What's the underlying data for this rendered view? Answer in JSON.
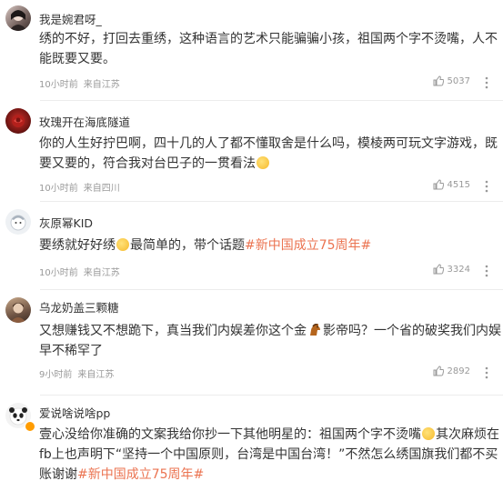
{
  "comments": [
    {
      "username": "我是婉君呀_",
      "text": "绣的不好，打回去重绣，这种语言的艺术只能骗骗小孩，祖国两个字不烫嘴，人不能既要又要。",
      "time": "10小时前",
      "location": "来自江苏",
      "likes": "5037"
    },
    {
      "username": "玫瑰开在海底隧道",
      "text_a": "你的人生好拧巴啊，四十几的人了都不懂取舍是什么吗，模棱两可玩文字游戏，既要又要的，符合我对台巴子的一贯看法",
      "time": "10小时前",
      "location": "来自四川",
      "likes": "4515"
    },
    {
      "username": "灰原幂KID",
      "text_a": "要绣就好好绣",
      "text_b": "最简单的，带个话题",
      "hashtag": "#新中国成立75周年#",
      "time": "10小时前",
      "location": "来自江苏",
      "likes": "3324"
    },
    {
      "username": "乌龙奶盖三颗糖",
      "text_a": "又想赚钱又不想跪下，真当我们内娱差你这个金",
      "text_b": "影帝吗？一个省的破奖我们内娱早不稀罕了",
      "time": "9小时前",
      "location": "来自江苏",
      "likes": "2892"
    },
    {
      "username": "爱说啥说啥pp",
      "text_a": "壹心没给你准确的文案我给你抄一下其他明星的：祖国两个字不烫嘴",
      "text_b": "其次麻烦在fb上也声明下“坚持一个中国原则，台湾是中国台湾！”不然怎么绣国旗我们都不买账谢谢",
      "hashtag": "#新中国成立75周年#"
    }
  ],
  "colors": {
    "text": "#333333",
    "meta": "#999999",
    "hashtag": "#eb7350",
    "divider": "#ececec"
  },
  "icons": {
    "like": "thumbs-up-icon",
    "more": "more-vertical-icon",
    "verified": "verified-badge-icon",
    "emoji": "emoji-icon"
  }
}
